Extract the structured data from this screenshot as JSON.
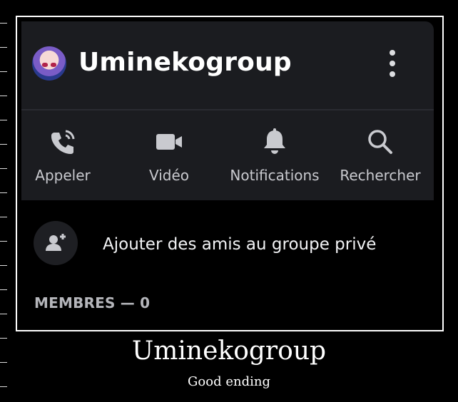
{
  "header": {
    "group_name": "Uminekogroup",
    "avatar_icon": "anime-avatar-icon",
    "menu_icon": "kebab-menu-icon"
  },
  "actions": [
    {
      "label": "Appeler",
      "icon": "phone-icon"
    },
    {
      "label": "Vidéo",
      "icon": "video-camera-icon"
    },
    {
      "label": "Notifications",
      "icon": "bell-icon"
    },
    {
      "label": "Rechercher",
      "icon": "search-icon"
    }
  ],
  "add_friends": {
    "label": "Ajouter des amis au groupe privé",
    "icon": "add-user-icon"
  },
  "members": {
    "heading": "MEMBRES — 0"
  },
  "caption": {
    "title": "Uminekogroup",
    "subtitle": "Good ending"
  },
  "colors": {
    "panel": "#1b1c20",
    "background": "#000000",
    "icon": "#c9cacf",
    "text": "#ffffff"
  }
}
